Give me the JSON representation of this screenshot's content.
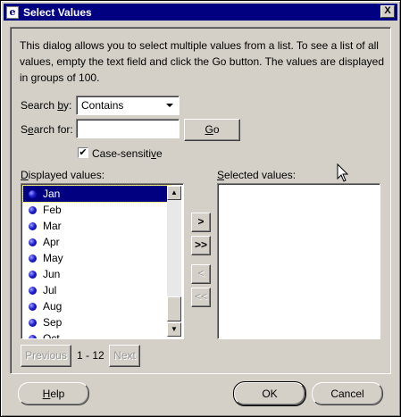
{
  "window": {
    "title": "Select Values",
    "close_glyph": "X"
  },
  "description": "This dialog allows you to select multiple values from a list. To see a list of all values, empty the text field and click the Go button. The values are displayed in groups of 100.",
  "search_by": {
    "label_prefix": "Search ",
    "label_accel": "b",
    "label_suffix": "y:",
    "value": "Contains"
  },
  "search_for": {
    "label_prefix": "S",
    "label_accel": "e",
    "label_suffix": "arch for:",
    "value": ""
  },
  "go_button": {
    "accel": "G",
    "rest": "o"
  },
  "case_sensitive": {
    "checked": true,
    "check_glyph": "✔",
    "label_prefix": "Case-sensiti",
    "label_accel": "v",
    "label_suffix": "e"
  },
  "displayed_values": {
    "label_accel": "D",
    "label_rest": "isplayed values:",
    "items": [
      "Jan",
      "Feb",
      "Mar",
      "Apr",
      "May",
      "Jun",
      "Jul",
      "Aug",
      "Sep",
      "Oct"
    ],
    "selected_index": 0
  },
  "selected_values": {
    "label_accel": "S",
    "label_rest": "elected values:",
    "items": []
  },
  "move_buttons": {
    "move": ">",
    "move_all": ">>",
    "remove": "<",
    "remove_all": "<<"
  },
  "paging": {
    "previous": "Previous",
    "range": "1 - 12",
    "next": "Next"
  },
  "footer": {
    "help_accel": "H",
    "help_rest": "elp",
    "ok": "OK",
    "cancel": "Cancel"
  },
  "colors": {
    "title_bar": "#000080",
    "selection": "#000080",
    "face": "#d4d0c8"
  }
}
